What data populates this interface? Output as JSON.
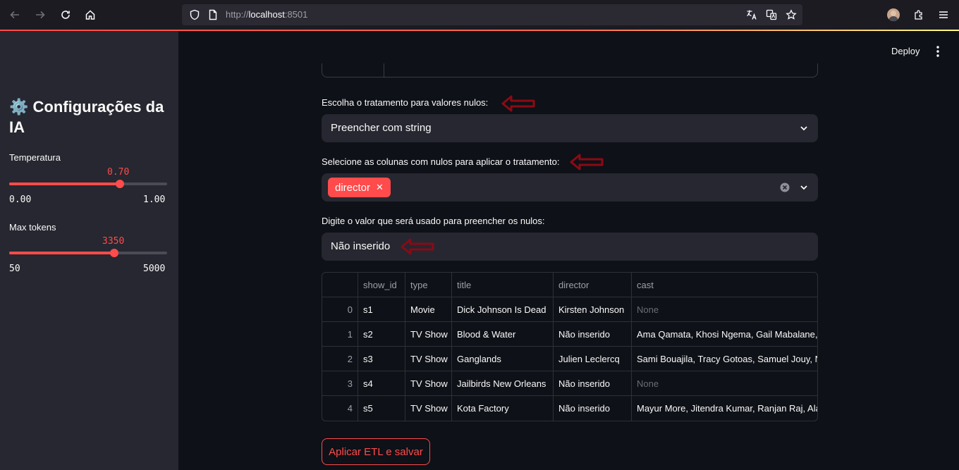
{
  "browser": {
    "url_prefix": "http://",
    "url_host": "localhost",
    "url_suffix": ":8501"
  },
  "sidebar": {
    "title": "⚙️ Configurações da IA",
    "temperature": {
      "label": "Temperatura",
      "value": "0.70",
      "min": "0.00",
      "max": "1.00",
      "fraction": 0.7
    },
    "max_tokens": {
      "label": "Max tokens",
      "value": "3350",
      "min": "50",
      "max": "5000",
      "fraction": 0.667
    }
  },
  "header": {
    "deploy_label": "Deploy"
  },
  "main": {
    "null_treatment": {
      "label": "Escolha o tratamento para valores nulos:",
      "value": "Preencher com string"
    },
    "columns_select": {
      "label": "Selecione as colunas com nulos para aplicar o tratamento:",
      "tags": [
        "director"
      ]
    },
    "fill_value": {
      "label": "Digite o valor que será usado para preencher os nulos:",
      "value": "Não inserido"
    },
    "table": {
      "columns": [
        "",
        "show_id",
        "type",
        "title",
        "director",
        "cast"
      ],
      "rows": [
        [
          "0",
          "s1",
          "Movie",
          "Dick Johnson Is Dead",
          "Kirsten Johnson",
          "None"
        ],
        [
          "1",
          "s2",
          "TV Show",
          "Blood & Water",
          "Não inserido",
          "Ama Qamata, Khosi Ngema, Gail Mabalane, T"
        ],
        [
          "2",
          "s3",
          "TV Show",
          "Ganglands",
          "Julien Leclercq",
          "Sami Bouajila, Tracy Gotoas, Samuel Jouy, N"
        ],
        [
          "3",
          "s4",
          "TV Show",
          "Jailbirds New Orleans",
          "Não inserido",
          "None"
        ],
        [
          "4",
          "s5",
          "TV Show",
          "Kota Factory",
          "Não inserido",
          "Mayur More, Jitendra Kumar, Ranjan Raj, Ala"
        ]
      ]
    },
    "apply_button": "Aplicar ETL e salvar"
  },
  "colors": {
    "accent": "#ff4b4b",
    "annotation_arrow": "#8b0a14"
  }
}
